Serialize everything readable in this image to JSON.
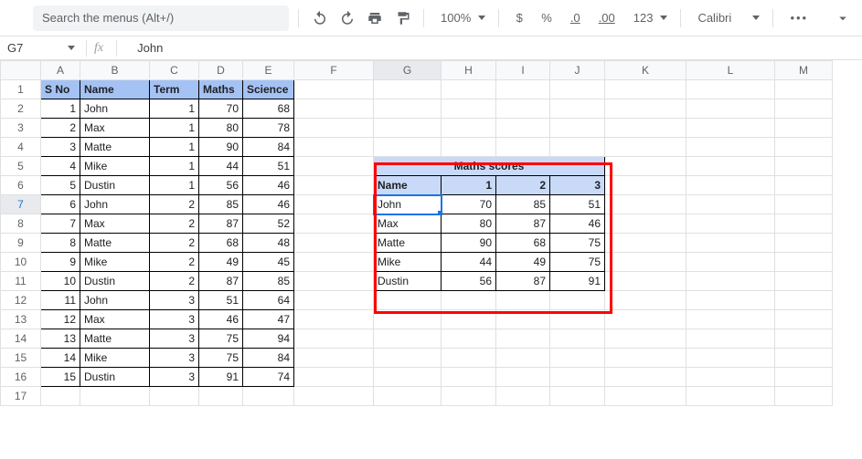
{
  "toolbar": {
    "search_placeholder": "Search the menus (Alt+/)",
    "zoom": "100%",
    "currency": "$",
    "percent": "%",
    "dec_dec": ".0",
    "dec_inc": ".00",
    "fmt_more": "123",
    "font": "Calibri",
    "more": "•••"
  },
  "namebox": {
    "cell": "G7",
    "fx": "fx",
    "formula": "John"
  },
  "columns": [
    "A",
    "B",
    "C",
    "D",
    "E",
    "F",
    "G",
    "H",
    "I",
    "J",
    "K",
    "L",
    "M"
  ],
  "left_table": {
    "headers": {
      "sno": "S No",
      "name": "Name",
      "term": "Term",
      "maths": "Maths",
      "science": "Science"
    },
    "rows": [
      {
        "sno": 1,
        "name": "John",
        "term": 1,
        "maths": 70,
        "science": 68
      },
      {
        "sno": 2,
        "name": "Max",
        "term": 1,
        "maths": 80,
        "science": 78
      },
      {
        "sno": 3,
        "name": "Matte",
        "term": 1,
        "maths": 90,
        "science": 84
      },
      {
        "sno": 4,
        "name": "Mike",
        "term": 1,
        "maths": 44,
        "science": 51
      },
      {
        "sno": 5,
        "name": "Dustin",
        "term": 1,
        "maths": 56,
        "science": 46
      },
      {
        "sno": 6,
        "name": "John",
        "term": 2,
        "maths": 85,
        "science": 46
      },
      {
        "sno": 7,
        "name": "Max",
        "term": 2,
        "maths": 87,
        "science": 52
      },
      {
        "sno": 8,
        "name": "Matte",
        "term": 2,
        "maths": 68,
        "science": 48
      },
      {
        "sno": 9,
        "name": "Mike",
        "term": 2,
        "maths": 49,
        "science": 45
      },
      {
        "sno": 10,
        "name": "Dustin",
        "term": 2,
        "maths": 87,
        "science": 85
      },
      {
        "sno": 11,
        "name": "John",
        "term": 3,
        "maths": 51,
        "science": 64
      },
      {
        "sno": 12,
        "name": "Max",
        "term": 3,
        "maths": 46,
        "science": 47
      },
      {
        "sno": 13,
        "name": "Matte",
        "term": 3,
        "maths": 75,
        "science": 94
      },
      {
        "sno": 14,
        "name": "Mike",
        "term": 3,
        "maths": 75,
        "science": 84
      },
      {
        "sno": 15,
        "name": "Dustin",
        "term": 3,
        "maths": 91,
        "science": 74
      }
    ]
  },
  "pivot": {
    "title": "Maths scores",
    "name_hdr": "Name",
    "cols": [
      "1",
      "2",
      "3"
    ],
    "rows": [
      {
        "name": "John",
        "v": [
          70,
          85,
          51
        ]
      },
      {
        "name": "Max",
        "v": [
          80,
          87,
          46
        ]
      },
      {
        "name": "Matte",
        "v": [
          90,
          68,
          75
        ]
      },
      {
        "name": "Mike",
        "v": [
          44,
          49,
          75
        ]
      },
      {
        "name": "Dustin",
        "v": [
          56,
          87,
          91
        ]
      }
    ]
  },
  "chart_data": {
    "type": "table",
    "title": "Maths scores",
    "categories": [
      "John",
      "Max",
      "Matte",
      "Mike",
      "Dustin"
    ],
    "series": [
      {
        "name": "1",
        "values": [
          70,
          80,
          90,
          44,
          56
        ]
      },
      {
        "name": "2",
        "values": [
          85,
          87,
          68,
          49,
          87
        ]
      },
      {
        "name": "3",
        "values": [
          51,
          46,
          75,
          75,
          91
        ]
      }
    ]
  }
}
